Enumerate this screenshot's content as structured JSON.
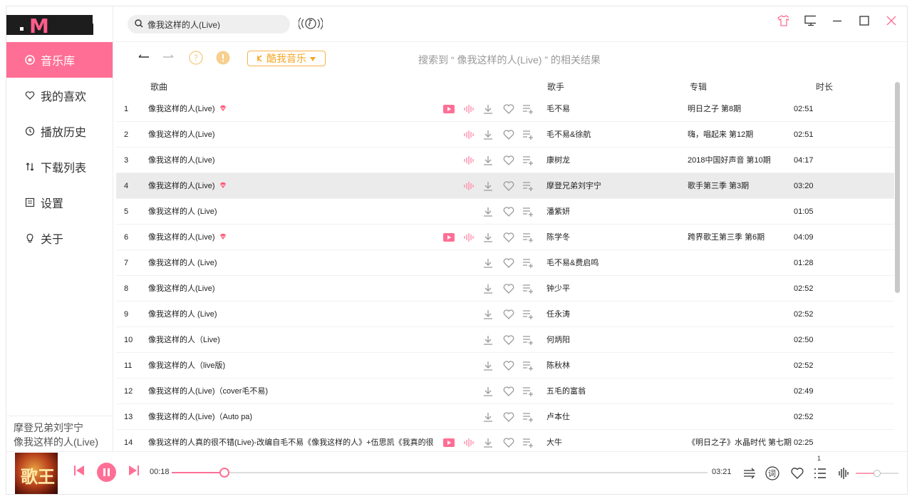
{
  "app": {
    "logo": "Morin"
  },
  "sidebar": {
    "items": [
      {
        "label": "音乐库",
        "icon": "music-library-icon",
        "active": true
      },
      {
        "label": "我的喜欢",
        "icon": "heart-icon",
        "active": false
      },
      {
        "label": "播放历史",
        "icon": "history-icon",
        "active": false
      },
      {
        "label": "下载列表",
        "icon": "download-sort-icon",
        "active": false
      },
      {
        "label": "设置",
        "icon": "settings-icon",
        "active": false
      },
      {
        "label": "关于",
        "icon": "bulb-icon",
        "active": false
      }
    ],
    "now_playing": {
      "artist": "摩登兄弟刘宇宁",
      "title": "像我这样的人(Live)"
    }
  },
  "search": {
    "value": "像我这样的人(Live)",
    "placeholder": ""
  },
  "toolbar": {
    "source": "酷我音乐",
    "result_info": "搜索到 “ 像我这样的人(Live) ” 的相关结果"
  },
  "table": {
    "headers": {
      "song": "歌曲",
      "artist": "歌手",
      "album": "专辑",
      "duration": "时长"
    },
    "rows": [
      {
        "idx": "1",
        "name": "像我这样的人(Live)",
        "vip": true,
        "mv": true,
        "quality": true,
        "artist": "毛不易",
        "album": "明日之子 第8期",
        "duration": "02:51"
      },
      {
        "idx": "2",
        "name": "像我这样的人(Live)",
        "vip": false,
        "mv": false,
        "quality": true,
        "artist": "毛不易&徐航",
        "album": "嗨，唱起来  第12期",
        "duration": "02:51"
      },
      {
        "idx": "3",
        "name": "像我这样的人(Live)",
        "vip": false,
        "mv": false,
        "quality": true,
        "artist": "康树龙",
        "album": "2018中国好声音 第10期",
        "duration": "04:17"
      },
      {
        "idx": "4",
        "name": "像我这样的人(Live)",
        "vip": true,
        "mv": false,
        "quality": true,
        "artist": "摩登兄弟刘宇宁",
        "album": "歌手第三季 第3期",
        "duration": "03:20",
        "highlight": true
      },
      {
        "idx": "5",
        "name": "像我这样的人 (Live)",
        "vip": false,
        "mv": false,
        "quality": false,
        "artist": "潘紫妍",
        "album": "",
        "duration": "01:05"
      },
      {
        "idx": "6",
        "name": "像我这样的人(Live)",
        "vip": true,
        "mv": true,
        "quality": true,
        "artist": "陈学冬",
        "album": "跨界歌王第三季 第6期",
        "duration": "04:09"
      },
      {
        "idx": "7",
        "name": "像我这样的人 (Live)",
        "vip": false,
        "mv": false,
        "quality": false,
        "artist": "毛不易&费启鸣",
        "album": "",
        "duration": "01:28"
      },
      {
        "idx": "8",
        "name": "像我这样的人(Live)",
        "vip": false,
        "mv": false,
        "quality": false,
        "artist": "钟少平",
        "album": "",
        "duration": "02:52"
      },
      {
        "idx": "9",
        "name": "像我这样的人 (Live)",
        "vip": false,
        "mv": false,
        "quality": false,
        "artist": "任永涛",
        "album": "",
        "duration": "02:52"
      },
      {
        "idx": "10",
        "name": "像我这样的人（Live)",
        "vip": false,
        "mv": false,
        "quality": false,
        "artist": "何炳阳",
        "album": "",
        "duration": "02:50"
      },
      {
        "idx": "11",
        "name": "像我这样的人（live版)",
        "vip": false,
        "mv": false,
        "quality": false,
        "artist": "陈秋林",
        "album": "",
        "duration": "02:52"
      },
      {
        "idx": "12",
        "name": "像我这样的人(Live)（cover毛不易)",
        "vip": false,
        "mv": false,
        "quality": false,
        "artist": "五毛的富翁",
        "album": "",
        "duration": "02:49"
      },
      {
        "idx": "13",
        "name": "像我这样的人(Live)（Auto pa)",
        "vip": false,
        "mv": false,
        "quality": false,
        "artist": "卢本仕",
        "album": "",
        "duration": "02:52"
      },
      {
        "idx": "14",
        "name": "像我这样的人真的很不错(Live)-改编自毛不易《像我这样的人》+伍思凯《我真的很",
        "vip": false,
        "mv": true,
        "quality": true,
        "artist": "大牛",
        "album": "《明日之子》水晶时代 第七期",
        "duration": "02:25"
      }
    ]
  },
  "player": {
    "cover_text": "歌王",
    "current_time": "00:18",
    "total_time": "03:21",
    "progress": 0.098,
    "volume": 0.5,
    "queue_count": "1",
    "lyrics_label": "词"
  },
  "colors": {
    "accent": "#ff6f95",
    "source": "#f5a623",
    "muted": "#999999"
  }
}
